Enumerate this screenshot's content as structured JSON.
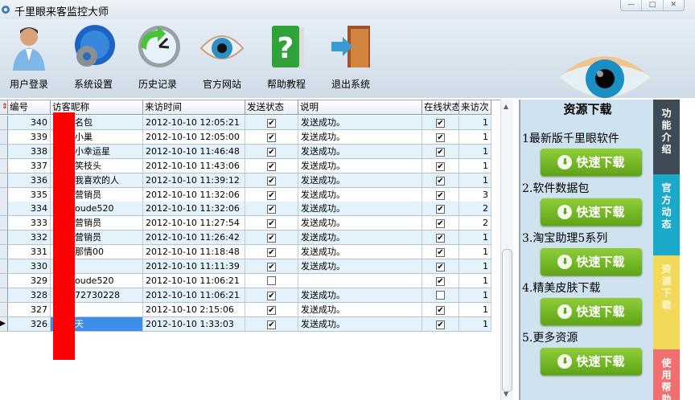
{
  "window": {
    "title": "千里眼来客监控大师",
    "controls": [
      "—",
      "□",
      "✕"
    ]
  },
  "toolbar": [
    {
      "label": "用户登录",
      "icon": "user-icon"
    },
    {
      "label": "系统设置",
      "icon": "globe-gear-icon"
    },
    {
      "label": "历史记录",
      "icon": "history-clock-icon"
    },
    {
      "label": "官方网站",
      "icon": "eye-icon"
    },
    {
      "label": "帮助教程",
      "icon": "help-book-icon"
    },
    {
      "label": "退出系统",
      "icon": "exit-door-icon"
    }
  ],
  "grid": {
    "columns": [
      "编号",
      "访客昵称",
      "来访时间",
      "发送状态",
      "说明",
      "在线状态",
      "来访次"
    ],
    "rows": [
      {
        "id": "340",
        "nick": "名包",
        "time": "2012-10-10 12:05:21",
        "sent": true,
        "note": "发送成功。",
        "online": true,
        "visits": "1"
      },
      {
        "id": "339",
        "nick": "小巢",
        "time": "2012-10-10 12:05:00",
        "sent": true,
        "note": "发送成功。",
        "online": true,
        "visits": "1"
      },
      {
        "id": "338",
        "nick": "小幸运星",
        "time": "2012-10-10 11:46:48",
        "sent": true,
        "note": "发送成功。",
        "online": true,
        "visits": "1"
      },
      {
        "id": "337",
        "nick": "笑枝头",
        "time": "2012-10-10 11:43:06",
        "sent": true,
        "note": "发送成功。",
        "online": true,
        "visits": "1"
      },
      {
        "id": "336",
        "nick": "我喜欢的人",
        "time": "2012-10-10 11:39:12",
        "sent": true,
        "note": "发送成功。",
        "online": true,
        "visits": "1"
      },
      {
        "id": "335",
        "nick": "营销员",
        "time": "2012-10-10 11:32:06",
        "sent": true,
        "note": "发送成功。",
        "online": true,
        "visits": "3"
      },
      {
        "id": "334",
        "nick": "oude520",
        "time": "2012-10-10 11:32:06",
        "sent": true,
        "note": "发送成功。",
        "online": true,
        "visits": "2"
      },
      {
        "id": "333",
        "nick": "营销员",
        "time": "2012-10-10 11:27:54",
        "sent": true,
        "note": "发送成功。",
        "online": true,
        "visits": "2"
      },
      {
        "id": "332",
        "nick": "营销员",
        "time": "2012-10-10 11:26:42",
        "sent": true,
        "note": "发送成功。",
        "online": true,
        "visits": "1"
      },
      {
        "id": "331",
        "nick": "那情00",
        "time": "2012-10-10 11:18:48",
        "sent": true,
        "note": "发送成功。",
        "online": true,
        "visits": "1"
      },
      {
        "id": "330",
        "nick": "",
        "time": "2012-10-10 11:11:39",
        "sent": true,
        "note": "发送成功。",
        "online": true,
        "visits": "1"
      },
      {
        "id": "329",
        "nick": "oude520",
        "time": "2012-10-10 11:06:21",
        "sent": false,
        "note": "",
        "online": true,
        "visits": "1"
      },
      {
        "id": "328",
        "nick": "72730228",
        "time": "2012-10-10 11:06:21",
        "sent": true,
        "note": "发送成功。",
        "online": false,
        "visits": "1"
      },
      {
        "id": "327",
        "nick": "",
        "time": "2012-10-10 2:15:06",
        "sent": true,
        "note": "发送成功。",
        "online": true,
        "visits": "1"
      },
      {
        "id": "326",
        "nick": "天",
        "time": "2012-10-10 1:33:03",
        "sent": true,
        "note": "发送成功。",
        "online": true,
        "visits": "1",
        "selected": true
      }
    ]
  },
  "panel": {
    "title": "资源下载",
    "items": [
      "1最新版千里眼软件",
      "2.软件数据包",
      "3.淘宝助理5系列",
      "4.精美皮肤下载",
      "5.更多资源"
    ],
    "button_label": "快速下载"
  },
  "tabs": [
    {
      "label": "功能介绍",
      "color": "#3e4a55"
    },
    {
      "label": "官方动态",
      "color": "#1aa9c9"
    },
    {
      "label": "资源下载",
      "color": "#f2d95a"
    },
    {
      "label": "使用帮助",
      "color": "#f07070"
    }
  ]
}
